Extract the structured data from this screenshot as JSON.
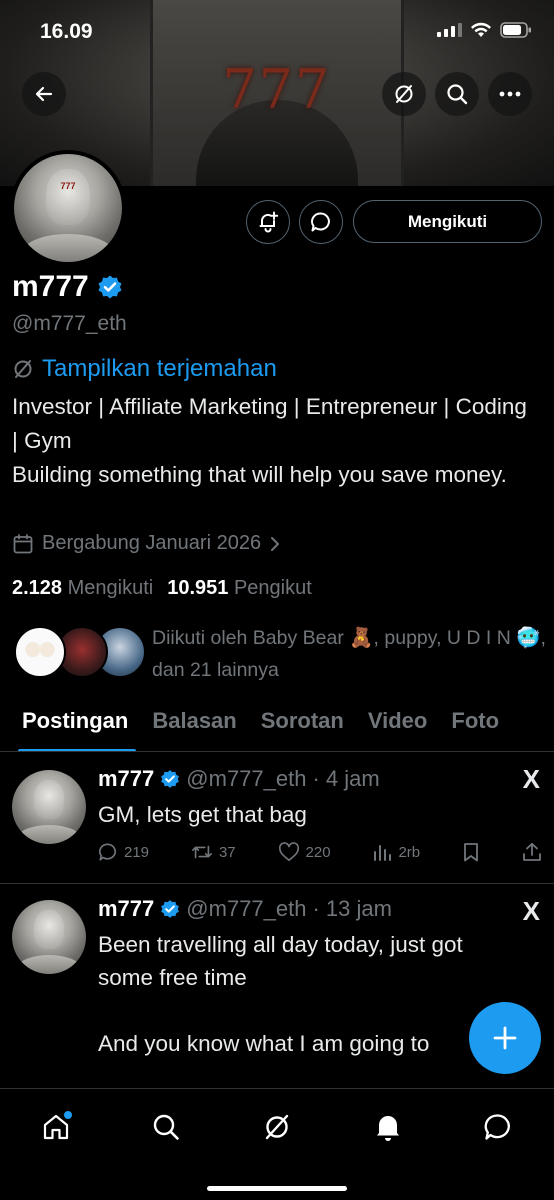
{
  "status_bar": {
    "time": "16.09"
  },
  "banner": {
    "text": "777"
  },
  "profile": {
    "display_name": "m777",
    "handle": "@m777_eth",
    "translate_label": "Tampilkan terjemahan",
    "bio_line1": "Investor | Affiliate Marketing | Entrepreneur | Coding | Gym",
    "bio_line2": "Building something that will help you save money.",
    "joined": "Bergabung Januari 2026",
    "following_count": "2.128",
    "following_label": "Mengikuti",
    "followers_count": "10.951",
    "followers_label": "Pengikut",
    "follow_button_label": "Mengikuti",
    "followed_by": "Diikuti oleh Baby Bear 🧸, puppy, U D I N 🥶, dan 21 lainnya"
  },
  "tabs": [
    {
      "label": "Postingan",
      "active": true
    },
    {
      "label": "Balasan",
      "active": false
    },
    {
      "label": "Sorotan",
      "active": false
    },
    {
      "label": "Video",
      "active": false
    },
    {
      "label": "Foto",
      "active": false
    }
  ],
  "tweets": [
    {
      "name": "m777",
      "handle": "@m777_eth",
      "time": "· 4 jam",
      "text": "GM, lets get that bag",
      "replies": "219",
      "reposts": "37",
      "likes": "220",
      "views": "2rb"
    },
    {
      "name": "m777",
      "handle": "@m777_eth",
      "time": "· 13 jam",
      "text_line1": "Been travelling all day today, just got some free time",
      "text_line2": "And you know what I am going to"
    }
  ],
  "x_logo": "X",
  "colors": {
    "accent": "#1d9bf0",
    "muted": "#71767b",
    "background": "#000000"
  },
  "icons": {
    "header": [
      "back-arrow-icon",
      "translate-icon",
      "search-icon",
      "more-icon"
    ],
    "nav": [
      "home-icon",
      "search-icon",
      "grok-icon",
      "notifications-icon",
      "messages-icon"
    ]
  }
}
